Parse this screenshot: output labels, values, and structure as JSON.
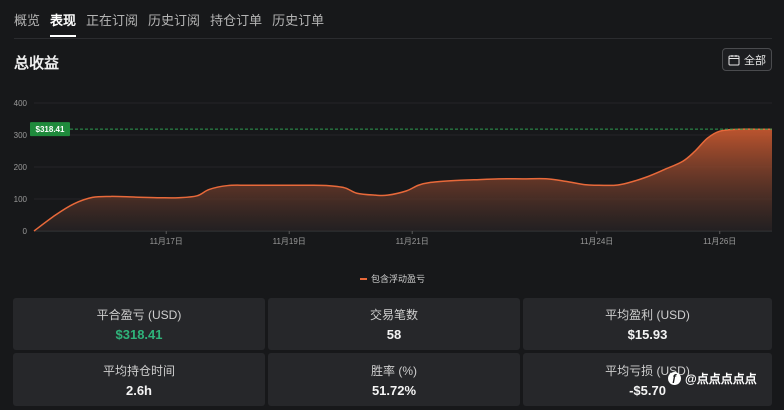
{
  "tabs": [
    "概览",
    "表现",
    "正在订阅",
    "历史订阅",
    "持仓订单",
    "历史订单"
  ],
  "active_tab": 1,
  "section_title": "总收益",
  "filter_button": {
    "label": "全部",
    "icon": "calendar-icon"
  },
  "chart_data": {
    "type": "area",
    "y_ticks": [
      0,
      100,
      200,
      300,
      400
    ],
    "ylim": [
      0,
      400
    ],
    "x_tick_labels": [
      "11月17日",
      "11月19日",
      "11月21日",
      "11月24日",
      "11月26日"
    ],
    "x_tick_days": [
      17,
      19,
      21,
      24,
      26
    ],
    "xlim": [
      14.85,
      26.85
    ],
    "series": [
      {
        "name": "包含浮动盈亏",
        "x": [
          14.85,
          15.2,
          15.5,
          15.8,
          16.1,
          16.5,
          16.9,
          17.2,
          17.5,
          17.7,
          18.0,
          18.3,
          18.6,
          18.9,
          19.3,
          19.6,
          19.9,
          20.1,
          20.4,
          20.6,
          20.9,
          21.1,
          21.3,
          21.7,
          22.0,
          22.4,
          22.8,
          23.2,
          23.5,
          23.8,
          24.0,
          24.3,
          24.5,
          24.8,
          25.1,
          25.4,
          25.6,
          25.8,
          26.0,
          26.3,
          26.6,
          26.85
        ],
        "y": [
          0,
          50,
          85,
          105,
          108,
          106,
          104,
          104,
          110,
          130,
          142,
          143,
          143,
          143,
          143,
          142,
          135,
          118,
          112,
          112,
          125,
          143,
          152,
          158,
          160,
          163,
          163,
          163,
          155,
          145,
          143,
          143,
          150,
          168,
          192,
          218,
          250,
          290,
          312,
          318,
          318,
          318
        ]
      }
    ],
    "annotation": {
      "label": "$318.41",
      "value": 318.41
    },
    "grid": true,
    "legend_position": "bottom-center"
  },
  "stats": [
    {
      "label": "平合盈亏 (USD)",
      "value": "$318.41",
      "color": "#2fb37a"
    },
    {
      "label": "交易笔数",
      "value": "58"
    },
    {
      "label": "平均盈利 (USD)",
      "value": "$15.93"
    },
    {
      "label": "平均持仓时间",
      "value": "2.6h"
    },
    {
      "label": "胜率 (%)",
      "value": "51.72%"
    },
    {
      "label": "平均亏损 (USD)",
      "value": "-$5.70"
    }
  ],
  "watermark": {
    "text": "@点点点点点",
    "icon": "logo-icon"
  },
  "colors": {
    "line": "#e8693a",
    "annotation_bg": "#1f8a3c",
    "positive": "#2fb37a"
  }
}
